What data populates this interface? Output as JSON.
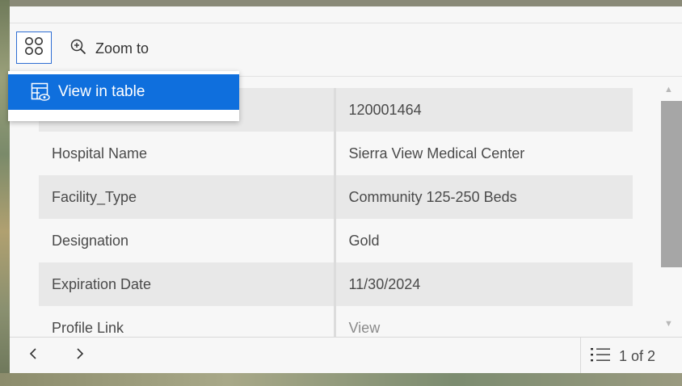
{
  "toolbar": {
    "actions_icon": "grid-four-circles-icon",
    "zoom_icon": "zoom-in-icon",
    "zoom_label": "Zoom to"
  },
  "menu": {
    "icon": "table-view-icon",
    "view_in_table_label": "View in table"
  },
  "fields": [
    {
      "label": "",
      "value": "120001464"
    },
    {
      "label": "Hospital Name",
      "value": "Sierra View Medical Center"
    },
    {
      "label": "Facility_Type",
      "value": "Community 125-250 Beds"
    },
    {
      "label": "Designation",
      "value": "Gold"
    },
    {
      "label": "Expiration Date",
      "value": "11/30/2024"
    },
    {
      "label": "Profile Link",
      "value": "View"
    }
  ],
  "footer": {
    "prev_icon": "chevron-left-icon",
    "next_icon": "chevron-right-icon",
    "list_icon": "list-icon",
    "page_label": "1 of 2"
  },
  "colors": {
    "accent": "#0f6fdd",
    "border_accent": "#2f6ed3",
    "row_alt": "#e8e8e8",
    "text": "#4a4a4a"
  }
}
